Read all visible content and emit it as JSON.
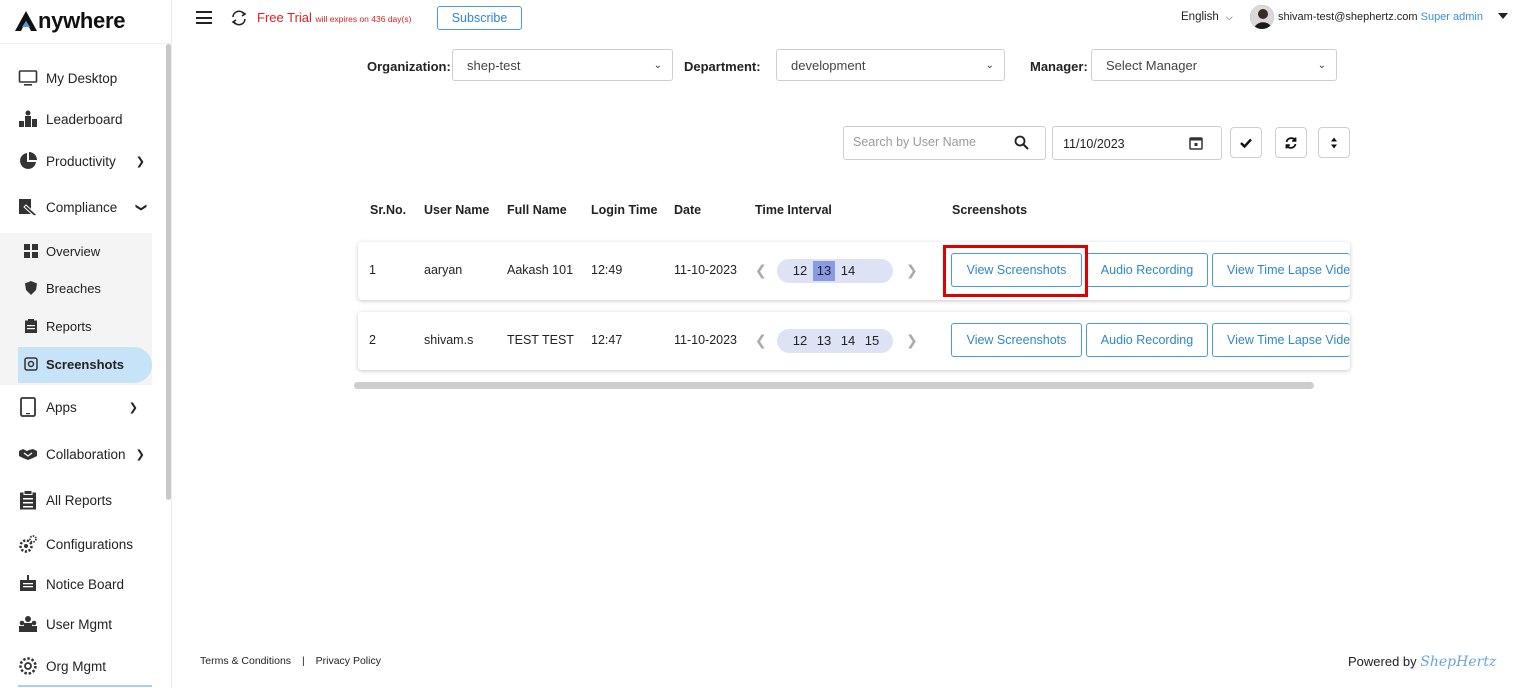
{
  "app": {
    "logo_text": "nywhere",
    "logo_mark": "A"
  },
  "sidebar": {
    "items": [
      {
        "label": "My Desktop",
        "icon": "monitor-icon"
      },
      {
        "label": "Leaderboard",
        "icon": "podium-icon"
      },
      {
        "label": "Productivity",
        "icon": "pie-chart-icon"
      },
      {
        "label": "Compliance",
        "icon": "compliance-icon"
      },
      {
        "label": "Apps",
        "icon": "tablet-icon"
      },
      {
        "label": "Collaboration",
        "icon": "handshake-icon"
      },
      {
        "label": "All Reports",
        "icon": "clipboard-icon"
      },
      {
        "label": "Configurations",
        "icon": "gears-icon"
      },
      {
        "label": "Notice Board",
        "icon": "notice-board-icon"
      },
      {
        "label": "User Mgmt",
        "icon": "users-icon"
      },
      {
        "label": "Org Mgmt",
        "icon": "org-gear-icon"
      }
    ],
    "compliance_sub": [
      {
        "label": "Overview",
        "icon": "grid-icon"
      },
      {
        "label": "Breaches",
        "icon": "shield-icon"
      },
      {
        "label": "Reports",
        "icon": "report-icon"
      },
      {
        "label": "Screenshots",
        "icon": "camera-icon",
        "active": true
      }
    ]
  },
  "topbar": {
    "trial_main": "Free Trial",
    "trial_small": "will expires on 436 day(s)",
    "subscribe_label": "Subscribe",
    "language": "English",
    "user_email": "shivam-test@shephertz.com",
    "user_role": "Super admin"
  },
  "filters": {
    "organization_label": "Organization:",
    "organization_value": "shep-test",
    "department_label": "Department:",
    "department_value": "development",
    "manager_label": "Manager:",
    "manager_value": "Select Manager",
    "search_placeholder": "Search by User Name",
    "date_value": "11/10/2023"
  },
  "table": {
    "headers": [
      "Sr.No.",
      "User Name",
      "Full Name",
      "Login Time",
      "Date",
      "Time Interval",
      "Screenshots"
    ],
    "rows": [
      {
        "sr": "1",
        "user": "aaryan",
        "full": "Aakash 101",
        "login": "12:49",
        "date": "11-10-2023",
        "hours": [
          "12",
          "13",
          "14"
        ],
        "selected_hour": "13"
      },
      {
        "sr": "2",
        "user": "shivam.s",
        "full": "TEST TEST",
        "login": "12:47",
        "date": "11-10-2023",
        "hours": [
          "12",
          "13",
          "14",
          "15"
        ],
        "selected_hour": ""
      }
    ],
    "actions": {
      "view_screenshots": "View Screenshots",
      "audio_recording": "Audio Recording",
      "time_lapse": "View Time Lapse Video"
    }
  },
  "footer": {
    "terms": "Terms & Conditions",
    "separator": "|",
    "privacy": "Privacy Policy",
    "powered_by": "Powered by",
    "brand": "ShepHertz"
  },
  "colors": {
    "accent": "#4a9bd8",
    "trial_red": "#e02020",
    "highlight_red": "#e00000",
    "active_bg": "#c6e3f7"
  }
}
